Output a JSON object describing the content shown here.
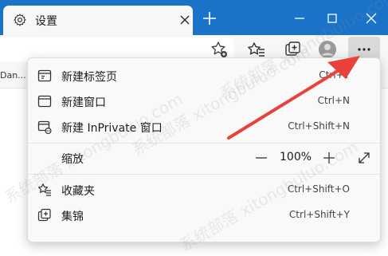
{
  "tab": {
    "title": "设置"
  },
  "favorites": {
    "item": "Dan..."
  },
  "menu": {
    "items": [
      {
        "label": "新建标签页",
        "shortcut": "Ctrl+T",
        "icon": "new-tab-icon"
      },
      {
        "label": "新建窗口",
        "shortcut": "Ctrl+N",
        "icon": "new-window-icon"
      },
      {
        "label": "新建 InPrivate 窗口",
        "shortcut": "Ctrl+Shift+N",
        "icon": "inprivate-icon"
      },
      {
        "label": "收藏夹",
        "shortcut": "Ctrl+Shift+O",
        "icon": "favorites-icon"
      },
      {
        "label": "集锦",
        "shortcut": "Ctrl+Shift+Y",
        "icon": "collections-icon"
      }
    ],
    "zoom": {
      "label": "缩放",
      "value": "100%"
    }
  },
  "watermark": "系统部落 xitongbuluo.com",
  "colors": {
    "titlebar": "#1a73c9",
    "arrow": "#e8423a"
  }
}
